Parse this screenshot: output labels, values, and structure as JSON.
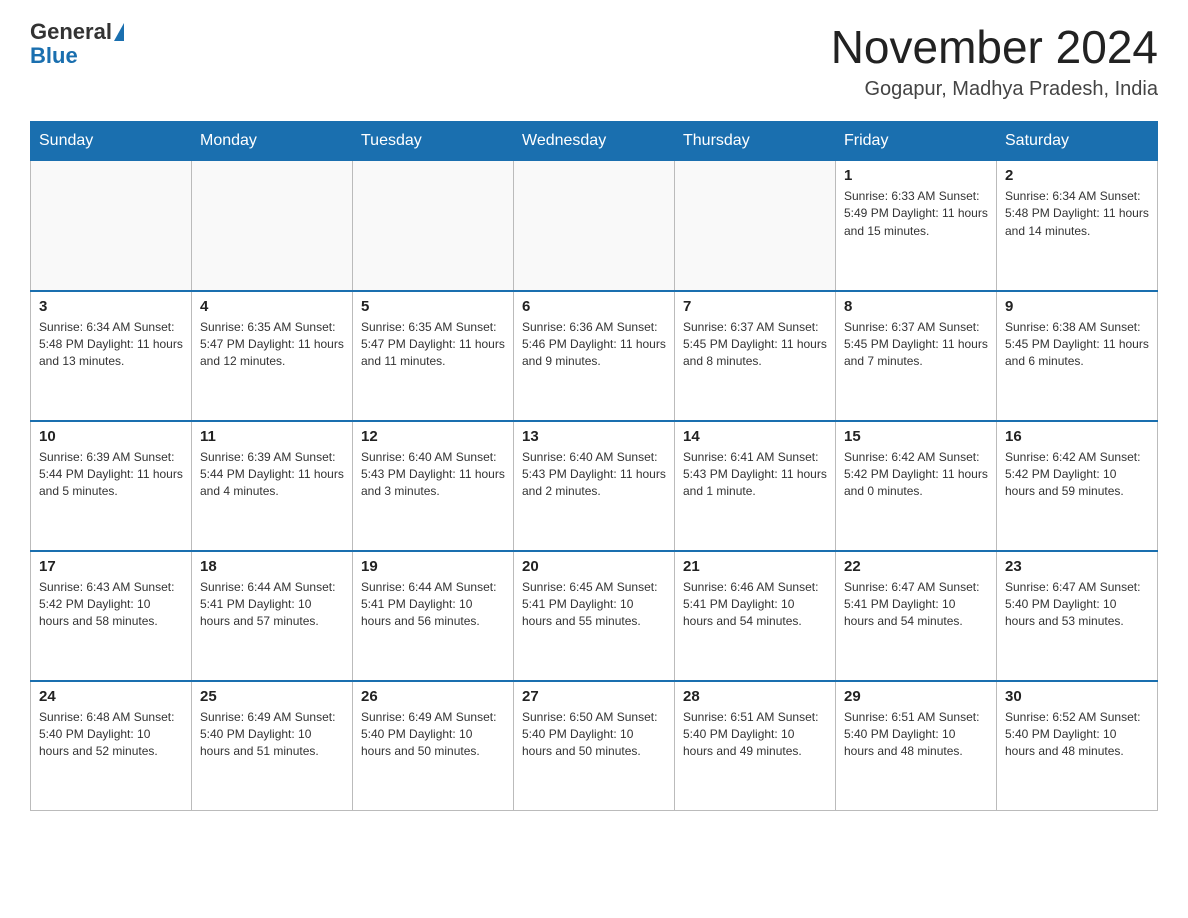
{
  "header": {
    "logo_general": "General",
    "logo_blue": "Blue",
    "title": "November 2024",
    "subtitle": "Gogapur, Madhya Pradesh, India"
  },
  "days_of_week": [
    "Sunday",
    "Monday",
    "Tuesday",
    "Wednesday",
    "Thursday",
    "Friday",
    "Saturday"
  ],
  "weeks": [
    [
      {
        "day": "",
        "info": ""
      },
      {
        "day": "",
        "info": ""
      },
      {
        "day": "",
        "info": ""
      },
      {
        "day": "",
        "info": ""
      },
      {
        "day": "",
        "info": ""
      },
      {
        "day": "1",
        "info": "Sunrise: 6:33 AM\nSunset: 5:49 PM\nDaylight: 11 hours and 15 minutes."
      },
      {
        "day": "2",
        "info": "Sunrise: 6:34 AM\nSunset: 5:48 PM\nDaylight: 11 hours and 14 minutes."
      }
    ],
    [
      {
        "day": "3",
        "info": "Sunrise: 6:34 AM\nSunset: 5:48 PM\nDaylight: 11 hours and 13 minutes."
      },
      {
        "day": "4",
        "info": "Sunrise: 6:35 AM\nSunset: 5:47 PM\nDaylight: 11 hours and 12 minutes."
      },
      {
        "day": "5",
        "info": "Sunrise: 6:35 AM\nSunset: 5:47 PM\nDaylight: 11 hours and 11 minutes."
      },
      {
        "day": "6",
        "info": "Sunrise: 6:36 AM\nSunset: 5:46 PM\nDaylight: 11 hours and 9 minutes."
      },
      {
        "day": "7",
        "info": "Sunrise: 6:37 AM\nSunset: 5:45 PM\nDaylight: 11 hours and 8 minutes."
      },
      {
        "day": "8",
        "info": "Sunrise: 6:37 AM\nSunset: 5:45 PM\nDaylight: 11 hours and 7 minutes."
      },
      {
        "day": "9",
        "info": "Sunrise: 6:38 AM\nSunset: 5:45 PM\nDaylight: 11 hours and 6 minutes."
      }
    ],
    [
      {
        "day": "10",
        "info": "Sunrise: 6:39 AM\nSunset: 5:44 PM\nDaylight: 11 hours and 5 minutes."
      },
      {
        "day": "11",
        "info": "Sunrise: 6:39 AM\nSunset: 5:44 PM\nDaylight: 11 hours and 4 minutes."
      },
      {
        "day": "12",
        "info": "Sunrise: 6:40 AM\nSunset: 5:43 PM\nDaylight: 11 hours and 3 minutes."
      },
      {
        "day": "13",
        "info": "Sunrise: 6:40 AM\nSunset: 5:43 PM\nDaylight: 11 hours and 2 minutes."
      },
      {
        "day": "14",
        "info": "Sunrise: 6:41 AM\nSunset: 5:43 PM\nDaylight: 11 hours and 1 minute."
      },
      {
        "day": "15",
        "info": "Sunrise: 6:42 AM\nSunset: 5:42 PM\nDaylight: 11 hours and 0 minutes."
      },
      {
        "day": "16",
        "info": "Sunrise: 6:42 AM\nSunset: 5:42 PM\nDaylight: 10 hours and 59 minutes."
      }
    ],
    [
      {
        "day": "17",
        "info": "Sunrise: 6:43 AM\nSunset: 5:42 PM\nDaylight: 10 hours and 58 minutes."
      },
      {
        "day": "18",
        "info": "Sunrise: 6:44 AM\nSunset: 5:41 PM\nDaylight: 10 hours and 57 minutes."
      },
      {
        "day": "19",
        "info": "Sunrise: 6:44 AM\nSunset: 5:41 PM\nDaylight: 10 hours and 56 minutes."
      },
      {
        "day": "20",
        "info": "Sunrise: 6:45 AM\nSunset: 5:41 PM\nDaylight: 10 hours and 55 minutes."
      },
      {
        "day": "21",
        "info": "Sunrise: 6:46 AM\nSunset: 5:41 PM\nDaylight: 10 hours and 54 minutes."
      },
      {
        "day": "22",
        "info": "Sunrise: 6:47 AM\nSunset: 5:41 PM\nDaylight: 10 hours and 54 minutes."
      },
      {
        "day": "23",
        "info": "Sunrise: 6:47 AM\nSunset: 5:40 PM\nDaylight: 10 hours and 53 minutes."
      }
    ],
    [
      {
        "day": "24",
        "info": "Sunrise: 6:48 AM\nSunset: 5:40 PM\nDaylight: 10 hours and 52 minutes."
      },
      {
        "day": "25",
        "info": "Sunrise: 6:49 AM\nSunset: 5:40 PM\nDaylight: 10 hours and 51 minutes."
      },
      {
        "day": "26",
        "info": "Sunrise: 6:49 AM\nSunset: 5:40 PM\nDaylight: 10 hours and 50 minutes."
      },
      {
        "day": "27",
        "info": "Sunrise: 6:50 AM\nSunset: 5:40 PM\nDaylight: 10 hours and 50 minutes."
      },
      {
        "day": "28",
        "info": "Sunrise: 6:51 AM\nSunset: 5:40 PM\nDaylight: 10 hours and 49 minutes."
      },
      {
        "day": "29",
        "info": "Sunrise: 6:51 AM\nSunset: 5:40 PM\nDaylight: 10 hours and 48 minutes."
      },
      {
        "day": "30",
        "info": "Sunrise: 6:52 AM\nSunset: 5:40 PM\nDaylight: 10 hours and 48 minutes."
      }
    ]
  ]
}
